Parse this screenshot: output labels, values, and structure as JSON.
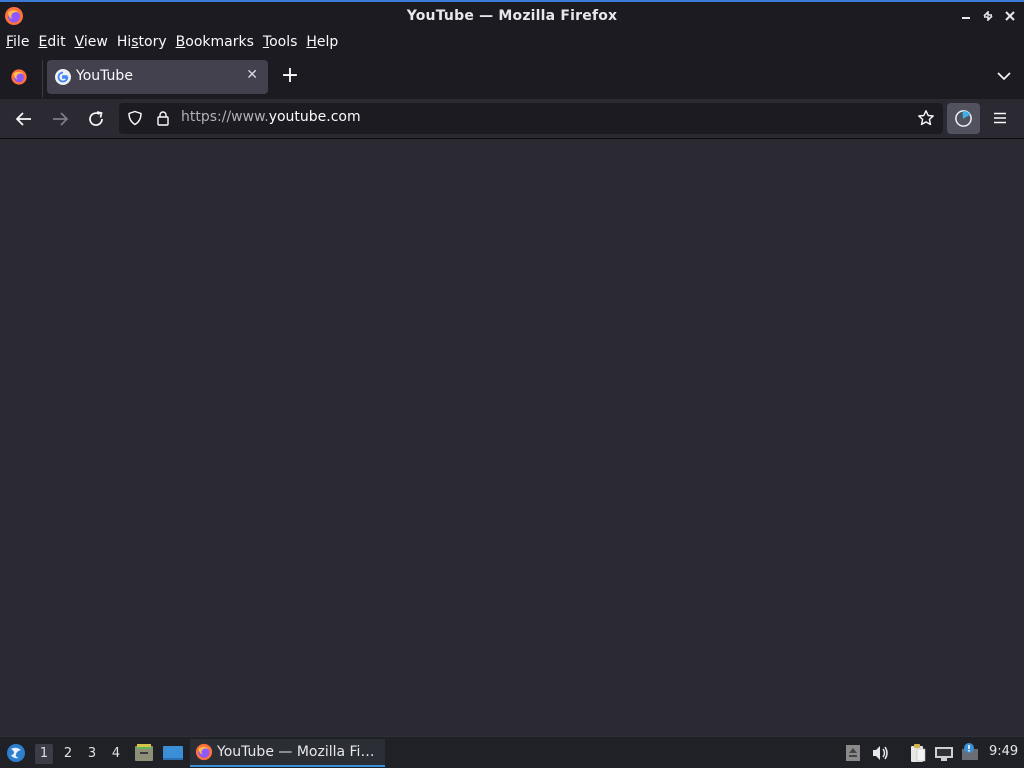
{
  "window": {
    "title": "YouTube — Mozilla Firefox"
  },
  "menubar": {
    "items": [
      {
        "label_u": "F",
        "label_rest": "ile"
      },
      {
        "label_u": "E",
        "label_rest": "dit"
      },
      {
        "label_u": "V",
        "label_rest": "iew"
      },
      {
        "label_pre": "Hi",
        "label_u": "s",
        "label_rest": "tory"
      },
      {
        "label_u": "B",
        "label_rest": "ookmarks"
      },
      {
        "label_u": "T",
        "label_rest": "ools"
      },
      {
        "label_u": "H",
        "label_rest": "elp"
      }
    ]
  },
  "tabs": [
    {
      "label": "YouTube",
      "favicon": "google-g-icon",
      "active": true
    }
  ],
  "tab_controls": {
    "new_tab": "+",
    "close": "✕"
  },
  "urlbar": {
    "url_prefix": "https://www.",
    "url_host": "youtube.com"
  },
  "taskbar": {
    "workspaces": [
      "1",
      "2",
      "3",
      "4"
    ],
    "active_workspace": "1",
    "task_label": "YouTube — Mozilla Fi…",
    "clock": "9:49"
  },
  "colors": {
    "chrome_bg": "#1c1b22",
    "content_bg": "#2b2a33",
    "tab_active": "#42414d",
    "accent": "#3b8fd6"
  }
}
